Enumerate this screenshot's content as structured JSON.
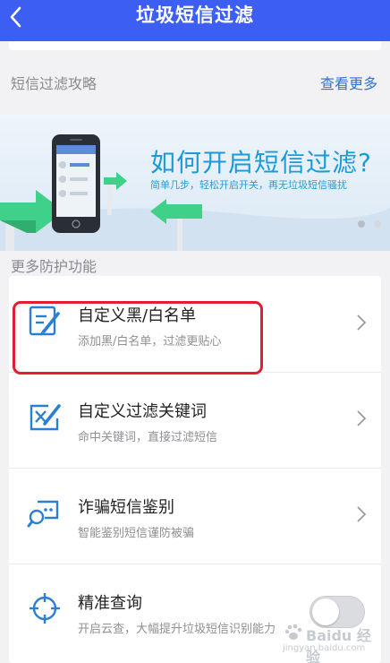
{
  "header": {
    "title": "垃圾短信过滤"
  },
  "guide_section": {
    "title": "短信过滤攻略",
    "more_link": "查看更多"
  },
  "banner": {
    "title": "如何开启短信过滤?",
    "subtitle": "简单几步，轻松开启开关，再无垃圾短信骚扰"
  },
  "protection_section": {
    "title": "更多防护功能",
    "items": [
      {
        "title": "自定义黑/白名单",
        "subtitle": "添加黑/白名单，过滤更贴心",
        "icon": "edit-list-icon"
      },
      {
        "title": "自定义过滤关键词",
        "subtitle": "命中关键词，直接过滤短信",
        "icon": "keyword-filter-icon"
      },
      {
        "title": "诈骗短信鉴别",
        "subtitle": "智能鉴别短信谨防被骗",
        "icon": "fraud-detect-icon"
      },
      {
        "title": "精准查询",
        "subtitle": "开启云查，大幅提升垃圾短信识别能力",
        "icon": "crosshair-icon"
      }
    ]
  },
  "cloud_query_toggle": {
    "on": false
  },
  "watermark": {
    "brand": "Baidu 经验",
    "url": "jingyan.baidu.com"
  },
  "colors": {
    "header": "#3d5ef3",
    "link": "#2f72d8",
    "banner_text": "#1a9ad6",
    "highlight": "#e21e2f",
    "icon": "#2a7fd4"
  }
}
